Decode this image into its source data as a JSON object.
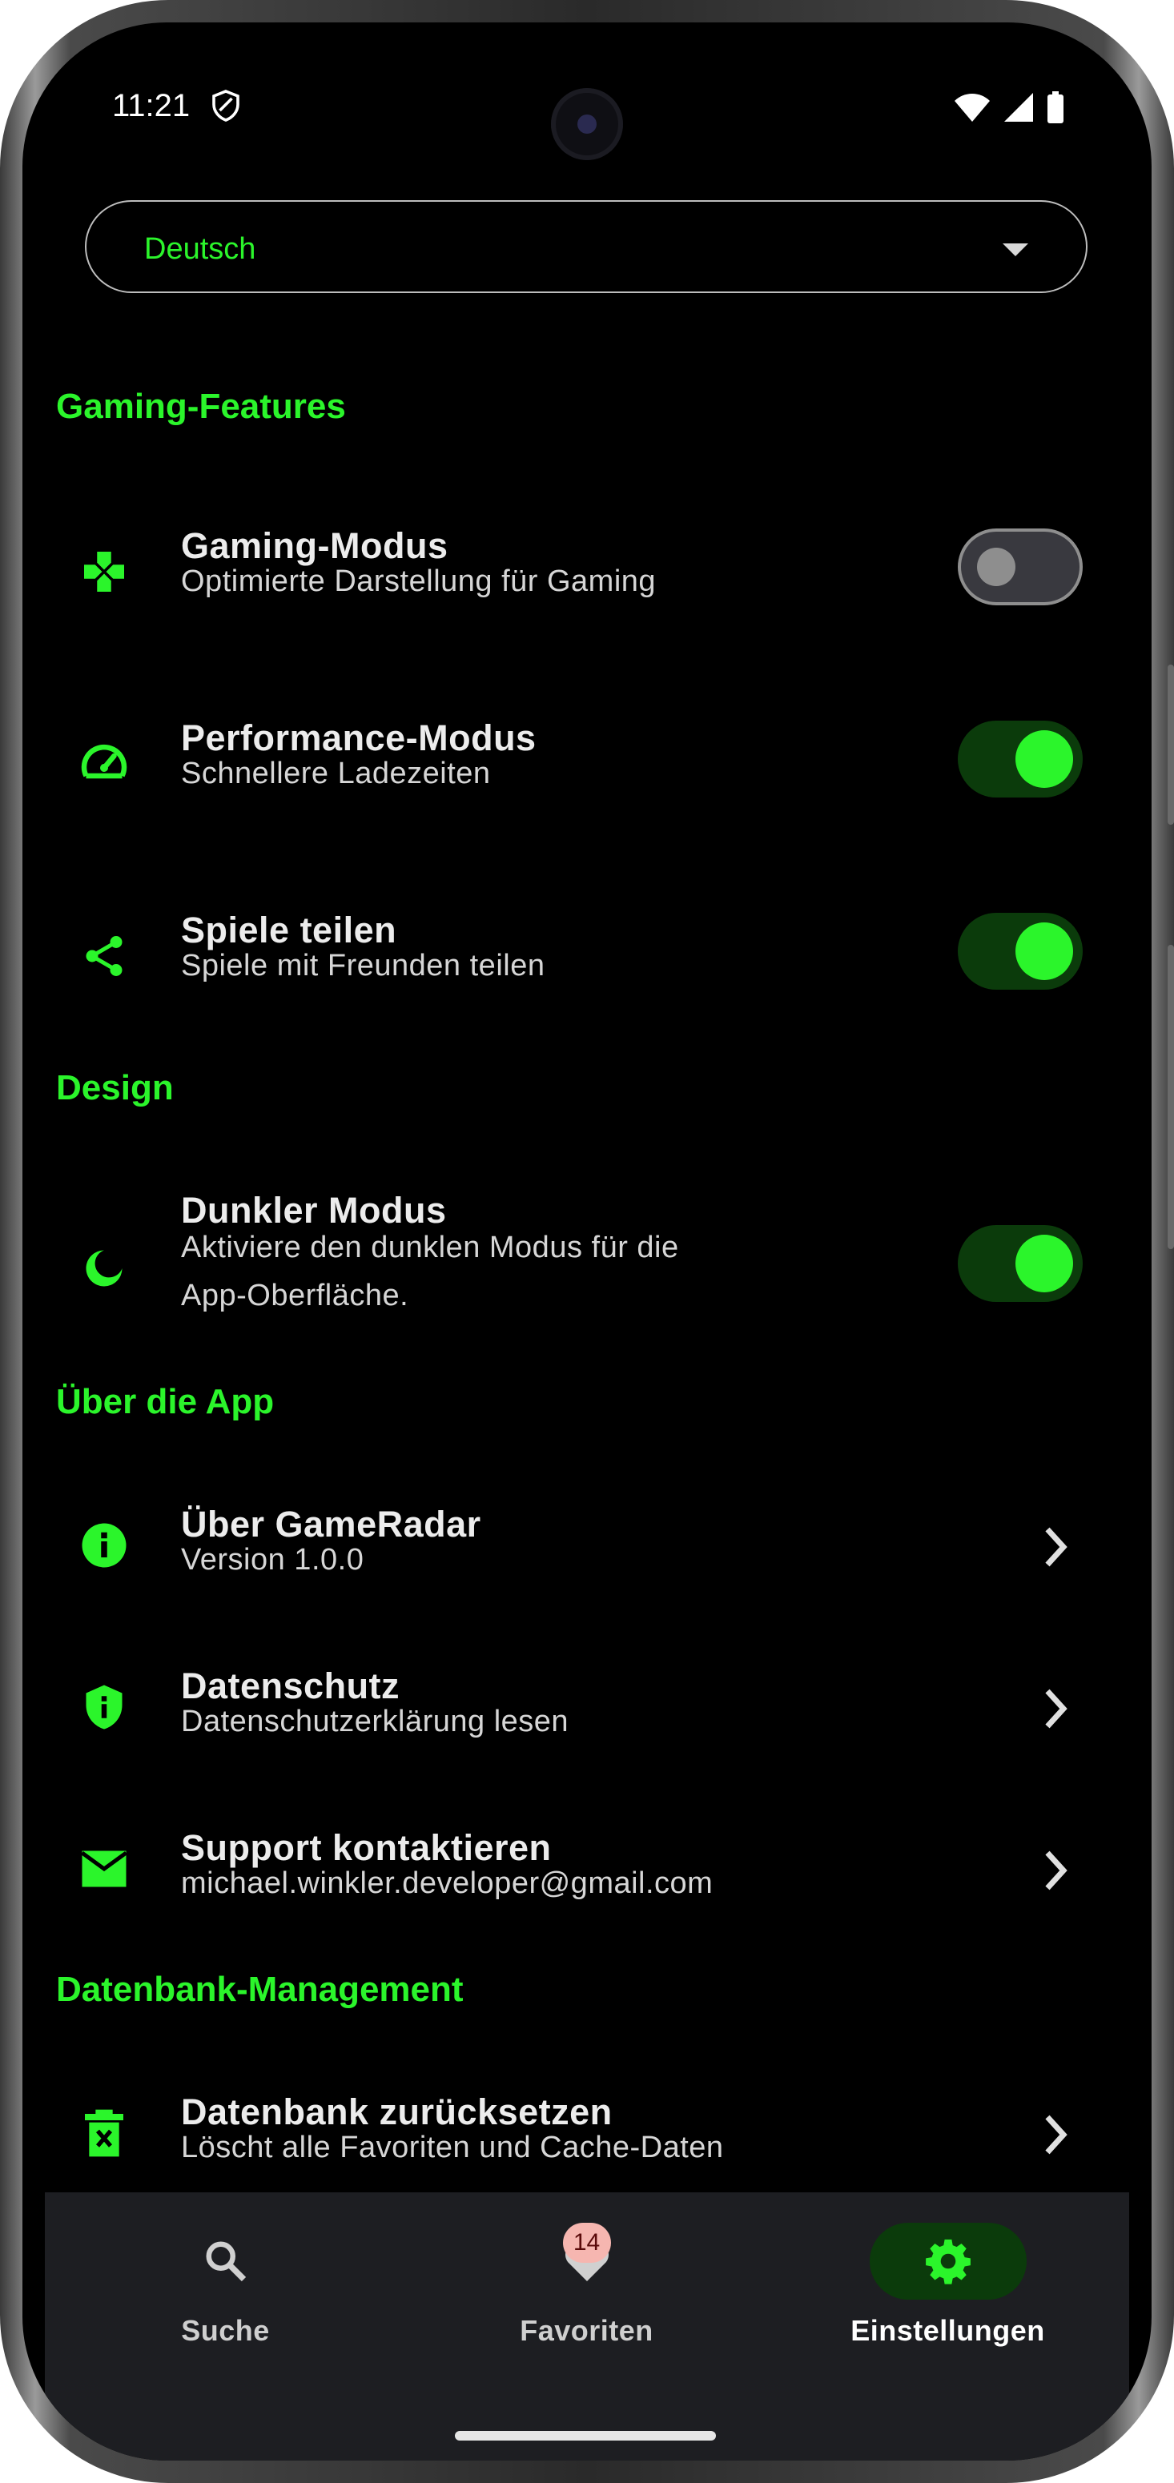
{
  "status_bar": {
    "time": "11:21"
  },
  "language_dropdown": {
    "selected": "Deutsch"
  },
  "sections": {
    "gaming": "Gaming-Features",
    "design": "Design",
    "about": "Über die App",
    "database": "Datenbank-Management"
  },
  "settings": {
    "gaming_mode": {
      "title": "Gaming-Modus",
      "subtitle": "Optimierte Darstellung für Gaming",
      "enabled": false,
      "icon": "gamepad-icon"
    },
    "performance_mode": {
      "title": "Performance-Modus",
      "subtitle": "Schnellere Ladezeiten",
      "enabled": true,
      "icon": "speedometer-icon"
    },
    "share_games": {
      "title": "Spiele teilen",
      "subtitle": "Spiele mit Freunden teilen",
      "enabled": true,
      "icon": "share-icon"
    },
    "dark_mode": {
      "title": "Dunkler Modus",
      "subtitle_line1": "Aktiviere den dunklen Modus für die",
      "subtitle_line2": "App-Oberfläche.",
      "enabled": true,
      "icon": "moon-icon"
    },
    "about_app": {
      "title": "Über GameRadar",
      "subtitle": "Version 1.0.0",
      "icon": "info-icon"
    },
    "privacy": {
      "title": "Datenschutz",
      "subtitle": "Datenschutzerklärung lesen",
      "icon": "shield-icon"
    },
    "support": {
      "title": "Support kontaktieren",
      "subtitle": "michael.winkler.developer@gmail.com",
      "icon": "mail-icon"
    },
    "reset_db": {
      "title": "Datenbank zurücksetzen",
      "subtitle": "Löscht alle Favoriten und Cache-Daten",
      "icon": "trash-icon"
    }
  },
  "bottom_nav": {
    "search": {
      "label": "Suche",
      "icon": "search-icon"
    },
    "favorites": {
      "label": "Favoriten",
      "badge": "14",
      "icon": "heart-icon"
    },
    "settings": {
      "label": "Einstellungen",
      "icon": "gear-icon",
      "active": true
    }
  },
  "colors": {
    "accent": "#2bf52b",
    "background": "#000000",
    "nav_background": "#1d1e22",
    "toggle_track_on": "#0b3b0b"
  }
}
